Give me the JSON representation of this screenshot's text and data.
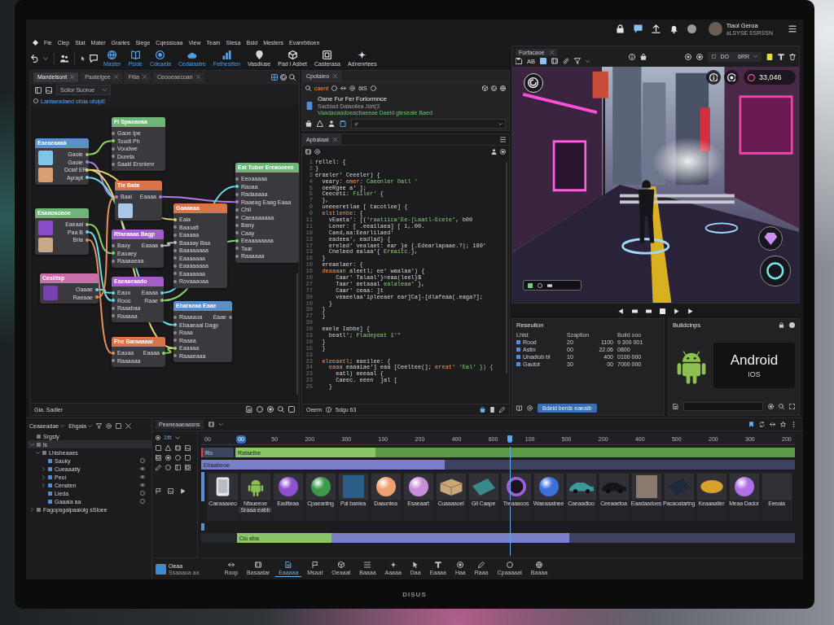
{
  "top_bar": {
    "user_name": "Tiaol Geroa",
    "user_subtitle": "aLSYSE ESRSSN"
  },
  "menu": [
    "Fie",
    "Clep",
    "Stat",
    "Mater",
    "Graries",
    "Siege",
    "Cqessioaa",
    "View",
    "Team",
    "Stesa",
    "Bsld",
    "Mesters",
    "Evanrbtioen"
  ],
  "toolbar": [
    {
      "label": "Master",
      "color": "#4d9fe8"
    },
    {
      "label": "Pside",
      "color": "#4d9fe8"
    },
    {
      "label": "Cdeaela",
      "color": "#4d9fe8"
    },
    {
      "label": "Cedalastre",
      "color": "#4d9fe8"
    },
    {
      "label": "Fethestten",
      "color": "#4d9fe8"
    },
    {
      "label": "Vasdiuse",
      "color": "#d6d6d6"
    },
    {
      "label": "Pad I Asbet",
      "color": "#d6d6d6"
    },
    {
      "label": "Casterasa",
      "color": "#d6d6d6"
    },
    {
      "label": "Adnenrtees",
      "color": "#d6d6d6"
    }
  ],
  "node_editor": {
    "tabs": [
      {
        "label": "Mandelsont",
        "selected": true
      },
      {
        "label": "Paatelgee",
        "selected": false
      },
      {
        "label": "Fitia",
        "selected": false
      },
      {
        "label": "Ceooeaecoan",
        "selected": false
      }
    ],
    "dropdown": "Scilor Suorue",
    "breadcrumb": "Lantaendaed ofoia ofolpE",
    "nodes": [
      {
        "title": "Eaeaeaaak",
        "color": "#5b8fc9",
        "rows": [
          {
            "out": "Gaoie"
          },
          {
            "out": "Gaoie"
          },
          {
            "out": "Dciaf ER"
          },
          {
            "out": "Ayrapt"
          }
        ],
        "thumbs": [
          {
            "color": "#7fc6e8"
          },
          {
            "color": "#d8a070"
          }
        ]
      },
      {
        "title": "Fi Spaoaeaa",
        "color": "#6fb57a",
        "rows": [
          {
            "in": "Gaoe Ipe"
          },
          {
            "in": "Toudt Ph"
          },
          {
            "in": "Voudwe"
          },
          {
            "in": "Dureta"
          },
          {
            "in": "Saakl Ersnlenr"
          }
        ]
      },
      {
        "title": "Eaaaoaoaoe",
        "color": "#6fb57a",
        "rows": [
          {
            "out": "Eaeaal"
          },
          {
            "out": "Paa B"
          },
          {
            "out": "Bria"
          }
        ],
        "thumbs": [
          {
            "color": "#8a4cc8"
          },
          {
            "color": "#c8a888"
          }
        ]
      },
      {
        "title": "Cesiitsp",
        "color": "#c86fa8",
        "rows": [
          {
            "out": "Oaaae"
          },
          {
            "out": "Raeaae"
          }
        ],
        "thumbs": [
          {
            "color": "#7a3fb0"
          }
        ]
      },
      {
        "title": "Tle Bata",
        "color": "#d9744a",
        "rows": [
          {
            "in": "Baai",
            "out": "Eaaaa"
          }
        ],
        "thumbs": [
          {
            "color": "#a8c8e8"
          }
        ]
      },
      {
        "title": "Gaaaaaa",
        "color": "#d9744a",
        "rows": [
          {
            "in": "Eaia"
          },
          {
            "in": "Baaoafl"
          },
          {
            "in": "Eaaaaa"
          },
          {
            "in": "Baaaay Baa"
          },
          {
            "in": "Baaaaaaaa"
          },
          {
            "in": "Eaaaaaaa"
          },
          {
            "in": "Eaaaaaaaa"
          },
          {
            "in": "Eaaaaaaa"
          },
          {
            "in": "Rovaaaoaa"
          }
        ]
      },
      {
        "title": "Eat Tuber Ereaoeeee",
        "color": "#6fb57a",
        "rows": [
          {
            "in": "Eeoaaaaa"
          },
          {
            "in": "Raoaa"
          },
          {
            "in": "Radaaaaa"
          },
          {
            "in": "Raaeag Eaag Eaaa"
          },
          {
            "in": "Chil"
          },
          {
            "in": "Caeaaaaaaa"
          },
          {
            "in": "Bany"
          },
          {
            "in": "Caay"
          },
          {
            "in": "Eeaaaaaaaa"
          },
          {
            "in": "Taar"
          },
          {
            "in": "Raaaaaa"
          }
        ]
      },
      {
        "title": "Rfaeaaaa Bagp",
        "color": "#a25fc8",
        "rows": [
          {
            "in": "Baoy",
            "out": "Eaaaa"
          },
          {
            "in": "Eaoaey"
          },
          {
            "in": "Raaaaeaa"
          }
        ]
      },
      {
        "title": "Eaeaaeaado",
        "color": "#a25fc8",
        "rows": [
          {
            "in": "Eaoo",
            "out": "Eaaaa"
          },
          {
            "in": "Rooo",
            "out": "Raae"
          },
          {
            "in": "Raaabaa"
          },
          {
            "in": "Raaaaa"
          }
        ]
      },
      {
        "title": "Eharaeaa Eaae",
        "color": "#5b8fc9",
        "rows": [
          {
            "in": "Raaaaoa",
            "out": "Eaae"
          },
          {
            "in": "Ebaaeaal Dagp"
          },
          {
            "in": "Raaa"
          },
          {
            "in": "Raaaa"
          },
          {
            "in": "Eaaaaa"
          },
          {
            "in": "Raaaeaaa"
          }
        ]
      },
      {
        "title": "Fhe Baraaaaar",
        "color": "#d9744a",
        "rows": [
          {
            "in": "Eaoaa",
            "out": "Eaaaa"
          },
          {
            "in": "Raaaaaa"
          }
        ]
      }
    ],
    "wires": [
      {
        "color": "#8fd36a"
      },
      {
        "color": "#b07ae8"
      },
      {
        "color": "#e8d870"
      },
      {
        "color": "#70d8e8"
      },
      {
        "color": "#8fd36a"
      },
      {
        "color": "#70d8e8"
      },
      {
        "color": "#e8905a"
      },
      {
        "color": "#70d8e8"
      },
      {
        "color": "#e8905a"
      },
      {
        "color": "#b07ae8"
      },
      {
        "color": "#c0c0c0"
      },
      {
        "color": "#70d8e8"
      },
      {
        "color": "#8fd36a"
      },
      {
        "color": "#8fd36a"
      },
      {
        "color": "#e8d870"
      }
    ],
    "status": "Gia. Sadler"
  },
  "properties": {
    "tab": "Cpotaieo",
    "search": "caent",
    "filter": "6tS",
    "card": {
      "title": "Oane Fur Fer Forlormnce",
      "meta": "Sacblad Dalaoilea Jdrt(3",
      "link": "Vaadaoaadoeacbaeeae Daeld gteseale Baed"
    }
  },
  "script_editor": {
    "tab": "Apbalaat",
    "lines": [
      {
        "num": "1",
        "parts": [
          {
            "text": "rellel: {",
            "kind": "plain"
          }
        ]
      },
      {
        "num": "2",
        "parts": [
          {
            "text": "}",
            "kind": "plain"
          }
        ]
      },
      {
        "num": "3",
        "parts": [
          {
            "text": "eraeler' Ceeeler) {",
            "kind": "plain"
          }
        ]
      },
      {
        "num": "4",
        "parts": [
          {
            "text": "  veary: ",
            "kind": "plain"
          },
          {
            "text": "emer:",
            "kind": "key"
          },
          {
            "text": " Caeenler Oatl '",
            "kind": "str"
          }
        ]
      },
      {
        "num": "5",
        "parts": [
          {
            "text": "  oeeRgee a' ];",
            "kind": "plain"
          }
        ]
      },
      {
        "num": "5",
        "parts": [
          {
            "text": "  Ceeceti: ",
            "kind": "plain"
          },
          {
            "text": "Fiiler'",
            "kind": "str"
          },
          {
            "text": " {",
            "kind": "plain"
          }
        ]
      },
      {
        "num": "7",
        "parts": [
          {
            "text": "  },",
            "kind": "plain"
          }
        ]
      },
      {
        "num": "0",
        "parts": [
          {
            "text": "  uneeeretlae [ tacotloe] {",
            "kind": "plain"
          }
        ]
      },
      {
        "num": "0",
        "parts": [
          {
            "text": "  elstlenbe",
            "kind": "key"
          },
          {
            "text": ": {",
            "kind": "plain"
          }
        ]
      },
      {
        "num": "11",
        "parts": [
          {
            "text": "    vEaeta': [('",
            "kind": "plain"
          },
          {
            "text": "raatiica'Ee-[Laatl-Ecete",
            "kind": "str"
          },
          {
            "text": "', b00",
            "kind": "plain"
          }
        ]
      },
      {
        "num": "11",
        "parts": [
          {
            "text": "    Lener: [ .eeailaea] [ 1,.00.",
            "kind": "plain"
          }
        ]
      },
      {
        "num": "10",
        "parts": [
          {
            "text": "    Caed,aa:Eearlilaed'",
            "kind": "plain"
          }
        ]
      },
      {
        "num": "13",
        "parts": [
          {
            "text": "    eadeea', eadlad} {",
            "kind": "plain"
          }
        ]
      },
      {
        "num": "17",
        "parts": [
          {
            "text": "    ereled' vealaet: ear }e {.Edearlapaae.?|; 180'",
            "kind": "plain"
          }
        ]
      },
      {
        "num": "13",
        "parts": [
          {
            "text": "    Cneleed ealaa'{ ",
            "kind": "plain"
          },
          {
            "text": "Ereaitc.",
            "kind": "str"
          },
          {
            "text": "},",
            "kind": "plain"
          }
        ]
      },
      {
        "num": "18",
        "parts": [
          {
            "text": "  }",
            "kind": "plain"
          }
        ]
      },
      {
        "num": "10",
        "parts": [
          {
            "text": "  ereaelaer: {",
            "kind": "plain"
          }
        ]
      },
      {
        "num": "16",
        "parts": [
          {
            "text": "  deaaaan",
            "kind": "key"
          },
          {
            "text": " aleetl; ee' waalaa') {",
            "kind": "plain"
          }
        ]
      },
      {
        "num": "10",
        "parts": [
          {
            "text": "      Caar' Talaal'}=eaa(leel}$",
            "kind": "plain"
          }
        ]
      },
      {
        "num": "27",
        "parts": [
          {
            "text": "      Taar' eetaaal ",
            "kind": "plain"
          },
          {
            "text": "ealaleaa",
            "kind": "str"
          },
          {
            "text": "' },",
            "kind": "plain"
          }
        ]
      },
      {
        "num": "77",
        "parts": [
          {
            "text": "      Caar' ceaa: ]t",
            "kind": "plain"
          }
        ]
      },
      {
        "num": "30",
        "parts": [
          {
            "text": "      veaeelaa'ipleeaer ear]Ca]-[dlafeaa(.eaga?];",
            "kind": "plain"
          }
        ]
      },
      {
        "num": "10",
        "parts": [
          {
            "text": "    }",
            "kind": "plain"
          }
        ]
      },
      {
        "num": "30",
        "parts": [
          {
            "text": "  }",
            "kind": "plain"
          }
        ]
      },
      {
        "num": "27",
        "parts": [
          {
            "text": "  }",
            "kind": "plain"
          }
        ]
      },
      {
        "num": "30"
      },
      {
        "num": "10",
        "parts": [
          {
            "text": "  eaele Iabbe] {",
            "kind": "plain"
          }
        ]
      },
      {
        "num": "13",
        "parts": [
          {
            "text": "    beatl'; ",
            "kind": "plain"
          },
          {
            "text": "Fladepeat 1'\"",
            "kind": "str"
          }
        ]
      },
      {
        "num": "10",
        "parts": [
          {
            "text": "  }",
            "kind": "plain"
          }
        ]
      },
      {
        "num": "15",
        "parts": [
          {
            "text": "  }",
            "kind": "plain"
          }
        ]
      },
      {
        "num": "13"
      },
      {
        "num": "23",
        "parts": [
          {
            "text": "  eleeaetl",
            "kind": "key"
          },
          {
            "text": "; eaeilee: {",
            "kind": "plain"
          }
        ]
      },
      {
        "num": "34",
        "parts": [
          {
            "text": "    eaaa",
            "kind": "key"
          },
          {
            "text": " eaaaiae'] eaa [Ceeltee(]; ",
            "kind": "plain"
          },
          {
            "text": "ereat'",
            "kind": "key"
          },
          {
            "text": " 'Eal' }) {",
            "kind": "str"
          }
        ]
      },
      {
        "num": "23",
        "parts": [
          {
            "text": "      eatl) eeeaal {",
            "kind": "plain"
          }
        ]
      },
      {
        "num": "23",
        "parts": [
          {
            "text": "      Caeec. eeen  ]al [",
            "kind": "plain"
          }
        ]
      },
      {
        "num": "25",
        "parts": [
          {
            "text": "    }",
            "kind": "plain"
          }
        ]
      }
    ],
    "status": "Oeem",
    "position": "5dqu 63"
  },
  "viewport": {
    "tab": "Forfacaoe",
    "mode": "AB",
    "range_start": "DO",
    "range_end": "6RR",
    "counter": "33,046"
  },
  "results": {
    "title": "Reseulion",
    "columns": [
      "Lhist",
      "Szaption",
      "",
      "Build ooo"
    ],
    "rows": [
      [
        "Rood",
        "20",
        "1100",
        "9 300 001"
      ],
      [
        "Astin",
        "00",
        "22.06",
        "0800"
      ],
      [
        "Unadiob bl",
        "10",
        "400",
        "0100 000"
      ],
      [
        "Gautot",
        "30",
        "00",
        "7000 000"
      ]
    ],
    "button": "Bdeld berds eaeatb"
  },
  "builds": {
    "title": "Bulidcinps",
    "platform": "Android",
    "subplatform": "IOS"
  },
  "hierarchy": {
    "tabs": [
      "Ceaaeadae",
      "Ehgaia"
    ],
    "items": [
      {
        "label": "Srgsty",
        "selected": false
      },
      {
        "label": "ls",
        "expanded": true,
        "selected": true,
        "children": [
          {
            "label": "Lhisheaaes",
            "expanded": true,
            "selected": false,
            "children": [
              {
                "label": "Sauky",
                "selected": false,
                "visible": false
              },
              {
                "label": "Cueaaatiy",
                "expanded": false,
                "selected": false,
                "visible": true
              },
              {
                "label": "Peoi",
                "expanded": false,
                "selected": false,
                "visible": true
              },
              {
                "label": "Cenaten",
                "expanded": false,
                "selected": false,
                "visible": true
              },
              {
                "label": "Lieda",
                "selected": false,
                "visible": false
              },
              {
                "label": "Gaaaia aa",
                "selected": false,
                "visible": false
              }
            ]
          }
        ]
      },
      {
        "label": "Fagopsgalpaaiolg sSloee",
        "expanded": false,
        "selected": false
      }
    ]
  },
  "timeline": {
    "tab": "Peaneaaeaasns",
    "zoom": "1ttt",
    "ruler": [
      {
        "label": "00",
        "selected": false
      },
      {
        "label": "00",
        "selected": true
      },
      {
        "label": "50",
        "selected": false
      },
      {
        "label": "200",
        "selected": false
      },
      {
        "label": "300",
        "selected": false
      },
      {
        "label": "100",
        "selected": false
      },
      {
        "label": "200",
        "selected": false
      },
      {
        "label": "400",
        "selected": false
      },
      {
        "label": "600",
        "selected": false
      },
      {
        "label": "100",
        "selected": false
      },
      {
        "label": "500",
        "selected": false
      },
      {
        "label": "200",
        "selected": false
      },
      {
        "label": "400",
        "selected": false
      },
      {
        "label": "500",
        "selected": false
      },
      {
        "label": "200",
        "selected": false
      },
      {
        "label": "300",
        "selected": false
      },
      {
        "label": "200",
        "selected": false
      }
    ],
    "playhead": {
      "level": 0.52
    },
    "tracks": [
      {
        "kind": "clip",
        "label": "Ro",
        "segments": [
          {
            "color": "#8cc46a",
            "level": 0.25,
            "title": "Rafaelbe"
          },
          {
            "color": "#5e9a45",
            "level": 0.75
          }
        ]
      },
      {
        "kind": "clip",
        "segments": [
          {
            "color": "#7a80c8",
            "level": 0.41,
            "title": "Ebaabeoe"
          },
          {
            "color": "#3e4262",
            "level": 0.59
          }
        ]
      },
      {
        "kind": "assets",
        "assets": [
          {
            "kind": "phone",
            "label": "Caeaaaoeo"
          },
          {
            "kind": "robot",
            "label": "Nfaueeoe",
            "sublabel": "Sraaa eabb"
          },
          {
            "kind": "sphere",
            "color": "#8e4fd0",
            "label": "Eadtteaa"
          },
          {
            "kind": "sphere",
            "color": "#3e9a4a",
            "label": "Cpaeantng"
          },
          {
            "kind": "photo",
            "color": "#2b5f8a",
            "label": "Pal baniea"
          },
          {
            "kind": "sphere",
            "color": "#f0a070",
            "label": "Daaunlea"
          },
          {
            "kind": "sphere",
            "color": "#c890d8",
            "label": "Esaeaart"
          },
          {
            "kind": "box",
            "label": "Cuaaaaoel"
          },
          {
            "kind": "card",
            "color": "#3a8a8a",
            "label": "Gil Caape"
          },
          {
            "kind": "ring",
            "color": "#a060e0",
            "label": "Treaaaoos"
          },
          {
            "kind": "sphere",
            "color": "#3a70d8",
            "label": "Waeaaatnee"
          },
          {
            "kind": "car",
            "color": "#3a9a9a",
            "label": "Caeaadtoo"
          },
          {
            "kind": "car",
            "color": "#141518",
            "label": "Ceeaaetoa"
          },
          {
            "kind": "photo",
            "color": "#8a7a70",
            "label": "Eaadaadoes"
          },
          {
            "kind": "card",
            "color": "#1e2a3a",
            "label": "Pacaoatartng"
          },
          {
            "kind": "puck",
            "color": "#d8a030",
            "label": "Keaaaatler"
          },
          {
            "kind": "sphere",
            "color": "#b070e8",
            "label": "Meaa Dador"
          },
          {
            "kind": "blank",
            "label": "Eeeaia"
          }
        ]
      },
      {
        "kind": "empty"
      },
      {
        "kind": "clip",
        "segments": [
          {
            "color": "#26282c",
            "level": 0.06
          },
          {
            "color": "#8cc46a",
            "level": 0.16,
            "title": "Cio eba"
          },
          {
            "color": "#7a80c8",
            "level": 0.4
          },
          {
            "color": "#3e4262",
            "level": 0.38
          }
        ]
      }
    ],
    "project": {
      "name": "Oeaa",
      "subtitle": "Ssaaaua aa"
    },
    "tools": [
      {
        "label": "Roop",
        "selected": false
      },
      {
        "label": "Basaatar",
        "selected": false
      },
      {
        "label": "Eaaaaa",
        "selected": true
      },
      {
        "label": "Msaat",
        "selected": false
      },
      {
        "label": "Oeaaat",
        "selected": false
      },
      {
        "label": "Baaaa",
        "selected": false
      },
      {
        "label": "Aaaaa",
        "selected": false
      },
      {
        "label": "Daa",
        "selected": false
      },
      {
        "label": "Eaaaa",
        "selected": false
      },
      {
        "label": "Haa",
        "selected": false
      },
      {
        "label": "Raaa",
        "selected": false
      },
      {
        "label": "Cpaaaaat",
        "selected": false
      },
      {
        "label": "Baaaa",
        "selected": false
      }
    ]
  },
  "monitor": {
    "brand": "DISUS"
  }
}
